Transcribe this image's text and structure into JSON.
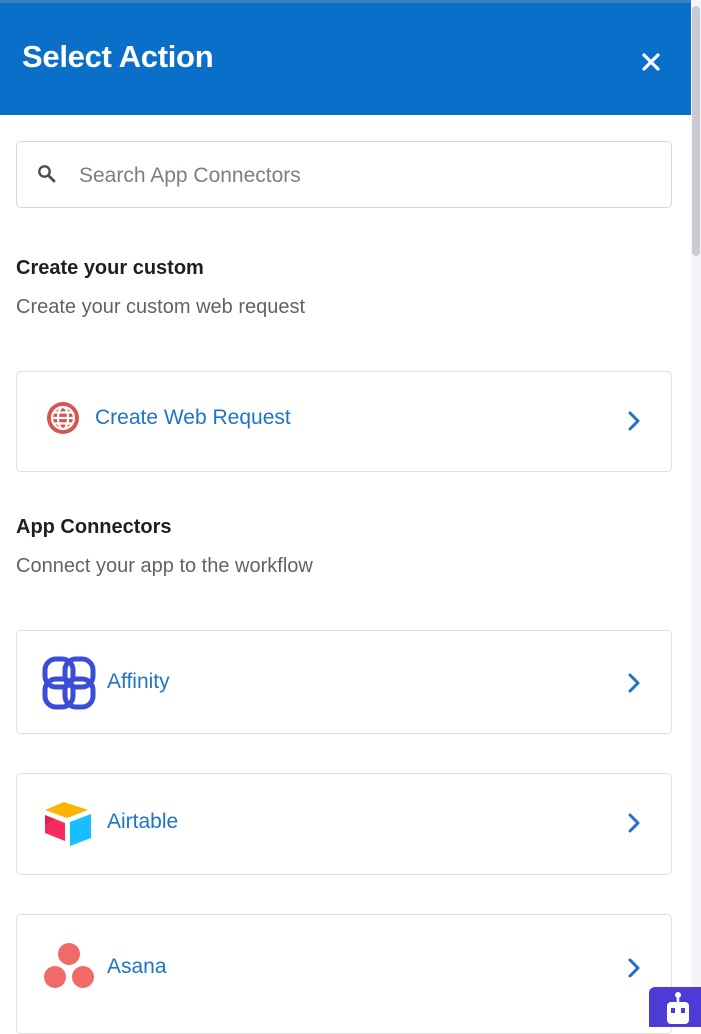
{
  "header": {
    "title": "Select Action"
  },
  "search": {
    "placeholder": "Search App Connectors"
  },
  "custom": {
    "title": "Create your custom",
    "subtitle": "Create your custom web request",
    "items": [
      {
        "label": "Create Web Request",
        "icon": "globe-icon"
      }
    ]
  },
  "connectors": {
    "title": "App Connectors",
    "subtitle": "Connect your app to the workflow",
    "items": [
      {
        "label": "Affinity",
        "icon": "affinity-logo-icon"
      },
      {
        "label": "Airtable",
        "icon": "airtable-logo-icon"
      },
      {
        "label": "Asana",
        "icon": "asana-logo-icon"
      }
    ]
  },
  "colors": {
    "header_bg": "#0a6fc9",
    "link": "#1f74c7",
    "globe": "#d9534f",
    "affinity": "#3b4cd8",
    "asana": "#f06a6a"
  }
}
